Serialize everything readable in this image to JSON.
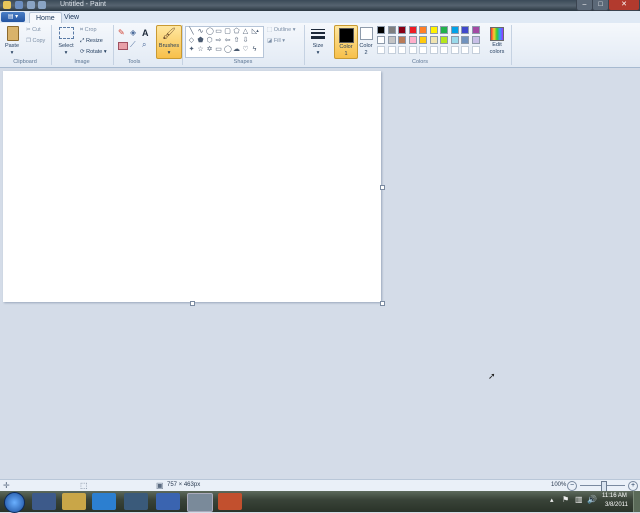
{
  "window": {
    "title": "Untitled - Paint"
  },
  "tabs": {
    "home": "Home",
    "view": "View"
  },
  "clipboard": {
    "paste": "Paste",
    "cut": "Cut",
    "copy": "Copy",
    "group": "Clipboard"
  },
  "image": {
    "select": "Select",
    "crop": "Crop",
    "resize": "Resize",
    "rotate": "Rotate",
    "group": "Image"
  },
  "tools": {
    "group": "Tools",
    "text_tool": "A"
  },
  "brushes": {
    "label": "Brushes"
  },
  "shapes": {
    "outline": "Outline",
    "fill": "Fill",
    "group": "Shapes"
  },
  "size": {
    "label": "Size"
  },
  "color1": {
    "label": "Color",
    "num": "1",
    "color": "#000000"
  },
  "color2": {
    "label": "Color",
    "num": "2",
    "color": "#ffffff"
  },
  "colors": {
    "group": "Colors",
    "edit_label": "Edit",
    "edit_label2": "colors",
    "row1": [
      "#000000",
      "#7f7f7f",
      "#880015",
      "#ed1c24",
      "#ff7f27",
      "#fff200",
      "#22b14c",
      "#00a2e8",
      "#3f48cc",
      "#a349a4"
    ],
    "row2": [
      "#ffffff",
      "#c3c3c3",
      "#b97a57",
      "#ffaec9",
      "#ffc90e",
      "#efe4b0",
      "#b5e61d",
      "#99d9ea",
      "#7092be",
      "#c8bfe7"
    ],
    "row3": [
      "#ffffff",
      "#ffffff",
      "#ffffff",
      "#ffffff",
      "#ffffff",
      "#ffffff",
      "#ffffff",
      "#ffffff",
      "#ffffff",
      "#ffffff"
    ]
  },
  "status": {
    "dimensions": "757 × 463px",
    "zoom": "100%"
  },
  "taskbar": {
    "time": "11:16 AM",
    "date": "3/8/2011"
  }
}
